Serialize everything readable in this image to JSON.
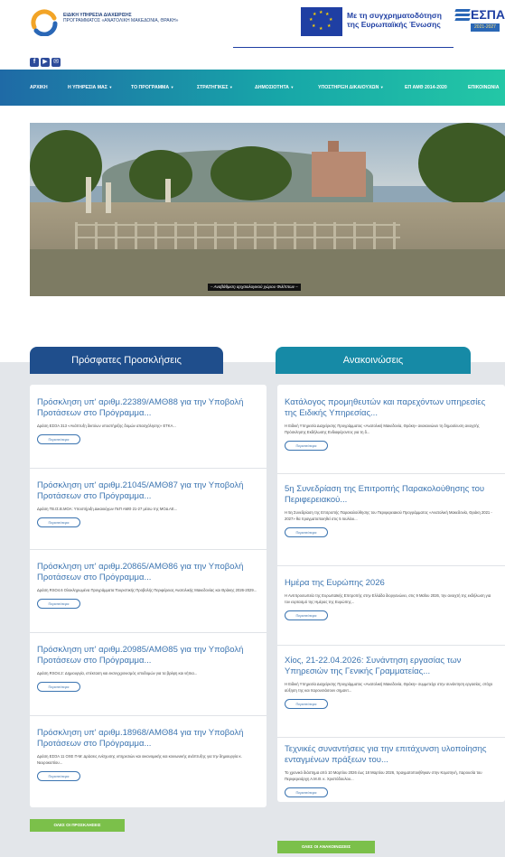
{
  "header": {
    "org_line1": "ΕΙΔΙΚΗ ΥΠΗΡΕΣΙΑ ΔΙΑΧΕΙΡΙΣΗΣ",
    "org_line2": "ΠΡΟΓΡΑΜΜΑΤΟΣ «ΑΝΑΤΟΛΙΚΗ ΜΑΚΕΔΟΝΙΑ, ΘΡΑΚΗ»",
    "eu_text": "Με τη συγχρηματοδότηση της Ευρωπαϊκής Ένωσης",
    "espa_word": "ΕΣΠΑ",
    "espa_years": "2021-2027"
  },
  "social": [
    "f",
    "▶",
    "✉"
  ],
  "nav": [
    {
      "label": "ΑΡΧΙΚΗ",
      "dropdown": false
    },
    {
      "label": "Η ΥΠΗΡΕΣΙΑ ΜΑΣ",
      "dropdown": true
    },
    {
      "label": "ΤΟ ΠΡΟΓΡΑΜΜΑ",
      "dropdown": true
    },
    {
      "label": "ΣΤΡΑΤΗΓΙΚΕΣ",
      "dropdown": true
    },
    {
      "label": "ΔΗΜΟΣΙΟΤΗΤΑ",
      "dropdown": true
    },
    {
      "label": "ΥΠΟΣΤΗΡΙΞΗ ΔΙΚΑΙΟΥΧΩΝ",
      "dropdown": true
    },
    {
      "label": "ΕΠ ΑΜΘ 2014-2020",
      "dropdown": false
    },
    {
      "label": "ΕΠΙΚΟΙΝΩΝΙΑ",
      "dropdown": false
    }
  ],
  "hero": {
    "caption": "– Αναβάθμιση αρχαιολογικού χώρου Φιλίππων –"
  },
  "calls": {
    "heading": "Πρόσφατες Προσκλήσεις",
    "items": [
      {
        "title": "Πρόσκληση υπ' αριθμ.22389/ΑΜΘ88 για την Υποβολή Προτάσεων στο Πρόγραμμα...",
        "desc": "Δράση ΕΣΟΑ 313 «Ανάπτυξη δικτύων υποστήριξης δομών απασχόλησης» ΕΤΚΑ..."
      },
      {
        "title": "Πρόσκληση υπ' αριθμ.21045/ΑΜΘ87 για την Υποβολή Προτάσεων στο Πρόγραμμα...",
        "desc": "Δράση ΤΒ.ΙΣ.Β.ΜΟΑ: Υποστήριξη Δικαιούχων ΠεΠ ΑΜΘ 21-27 μέσω της ΜΟΔ ΑΕ..."
      },
      {
        "title": "Πρόσκληση υπ' αριθμ.20865/ΑΜΘ86 για την Υποβολή Προτάσεων στο Πρόγραμμα...",
        "desc": "Δράση RSO4.6 Ολοκληρωμένα Προγράμματα Τουριστικής Προβολής Περιφέρειας Ανατολικής Μακεδονίας και Θράκης 2026-2029..."
      },
      {
        "title": "Πρόσκληση υπ' αριθμ.20985/ΑΜΘ85 για την Υποβολή Προτάσεων στο Πρόγραμμα...",
        "desc": "Δράση RSO4.2: Δημιουργία, επέκταση και εκσυγχρονισμός υποδομών για τα βρέφη και νήπια..."
      },
      {
        "title": "Πρόσκληση υπ' αριθμ.18968/ΑΜΘ84 για την Υποβολή Προτάσεων στο Πρόγραμμα...",
        "desc": "Δράση ΕΣΟΑ 11 ΟΧΕ Π-Μ: Δράσεις ενίσχυσης υπηρεσιών και οικονομικής και κοινωνικής ανάπτυξης για την δημιουργία κ. Νευροκοπίου..."
      }
    ],
    "more_label": "Περισσότερα",
    "all_button": "ΟΛΕΣ ΟΙ ΠΡΟΣΚΛΗΣΕΙΣ"
  },
  "announcements": {
    "heading": "Ανακοινώσεις",
    "items": [
      {
        "title": "Κατάλογος προμηθευτών και παρεχόντων υπηρεσίες της Ειδικής Υπηρεσίας...",
        "desc": "Η Ειδική Υπηρεσία Διαχείρισης Προγράμματος «Ανατολική Μακεδονία, Θράκη» ανακοινώνει τη δημοσίευση ανοιχτής Πρόσκλησης Εκδήλωσης Ενδιαφέροντος για τη δ..."
      },
      {
        "title": "5η Συνεδρίαση της Επιτροπής Παρακολούθησης του Περιφερειακού...",
        "desc": "Η 5η Συνεδρίαση της Επιτροπής Παρακολούθησης του Περιφερειακού Προγράμματος «Ανατολική Μακεδονία, Θράκη 2021 - 2027» θα πραγματοποιηθεί στις 5 Ιουλίου..."
      },
      {
        "title": "Ημέρα της Ευρώπης 2026",
        "desc": "Η Αντιπροσωπεία της Ευρωπαϊκής Επιτροπής στην Ελλάδα διοργανώνει, στις 9 Μαΐου 2026, την ανοιχτή της εκδήλωση για τον εορτασμό της Ημέρας της Ευρώπης..."
      },
      {
        "title": "Χίος, 21-22.04.2026: Συνάντηση εργασίας των Υπηρεσιών της Γενικής Γραμματείας...",
        "desc": "Η Ειδική Υπηρεσία Διαχείρισης Προγράμματος «Ανατολική Μακεδονία, Θράκη» συμμετείχε στην συνάντηση εργασίας, στόχο αύξηση της και παρουσιάσουν σημαντ..."
      },
      {
        "title": "Τεχνικές συναντήσεις για την επιτάχυνση υλοποίησης ενταγμένων πράξεων του...",
        "desc": "Το χρονικό διάστημα από 10 Μαρτίου 2026 έως 18 Μαρτίου 2026, πραγματοποιήθηκαν στην Κομοτηνή, παρουσία του Περιφερειάρχη Α.Μ.Θ. κ. Χριστόδουλου..."
      }
    ],
    "more_label": "Περισσότερα",
    "all_button": "ΟΛΕΣ ΟΙ ΑΝΑΚΟΙΝΩΣΕΙΣ"
  }
}
